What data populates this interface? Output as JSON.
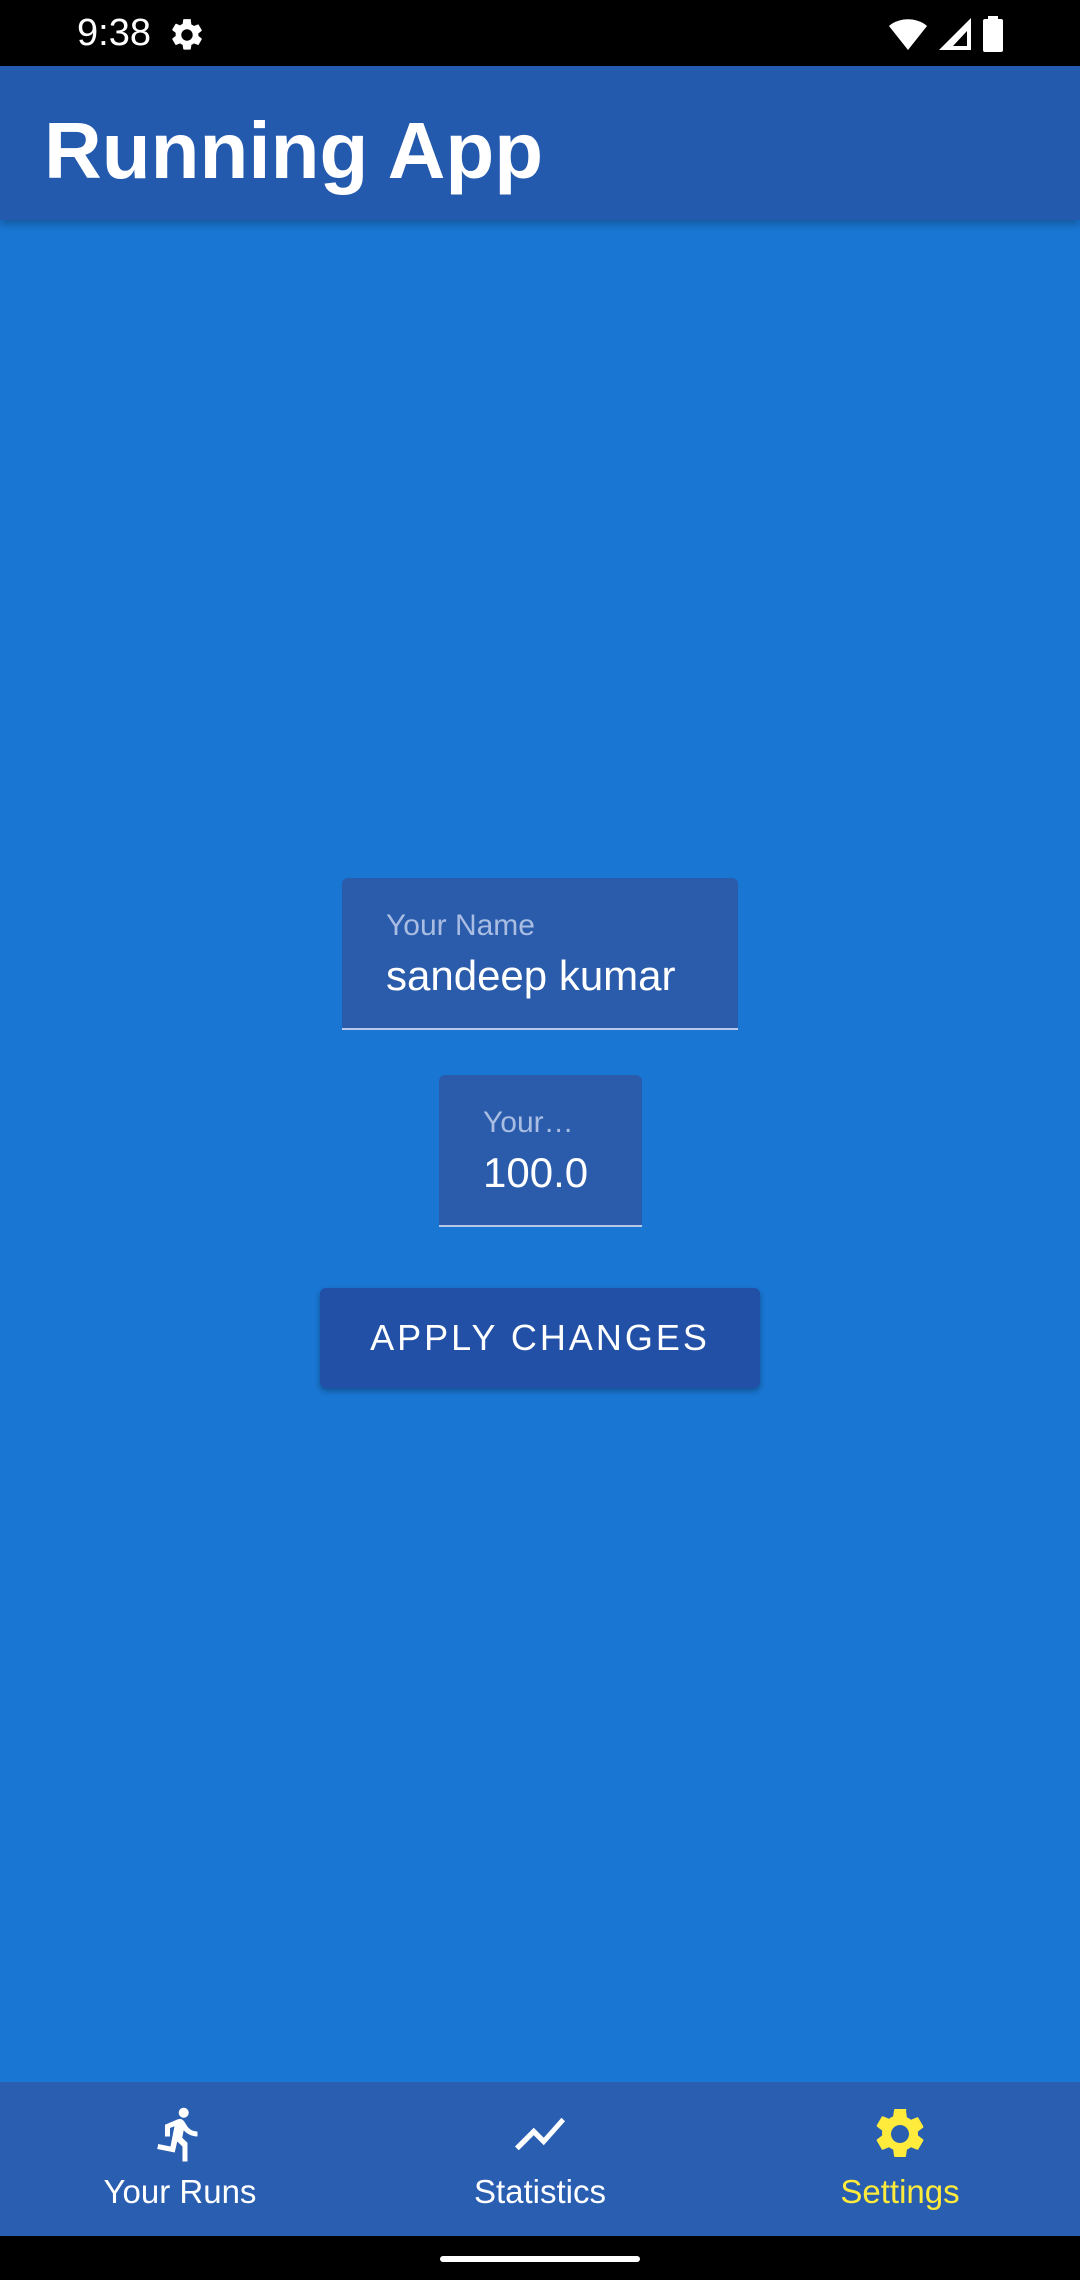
{
  "status_bar": {
    "time": "9:38",
    "icons": [
      "gear-icon",
      "wifi-icon",
      "signal-icon",
      "battery-icon"
    ]
  },
  "app_bar": {
    "title": "Running App"
  },
  "form": {
    "name_field": {
      "label": "Your Name",
      "value": "sandeep kumar"
    },
    "weight_field": {
      "label": "Your…",
      "value": "100.0"
    },
    "apply_label": "APPLY CHANGES"
  },
  "bottom_nav": {
    "items": [
      {
        "label": "Your Runs",
        "icon": "running-icon",
        "active": false
      },
      {
        "label": "Statistics",
        "icon": "trending-icon",
        "active": false
      },
      {
        "label": "Settings",
        "icon": "settings-icon",
        "active": true
      }
    ]
  },
  "colors": {
    "background": "#1976d2",
    "app_bar": "#245aad",
    "field_background": "#2a5cab",
    "button": "#2250a6",
    "bottom_nav": "#2a5eb0",
    "active_nav": "#ffeb3b"
  }
}
